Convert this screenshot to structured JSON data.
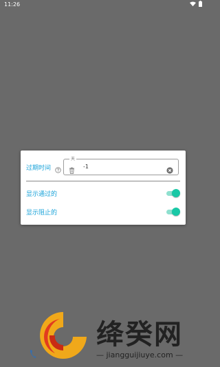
{
  "status_bar": {
    "time": "11:26",
    "icons": [
      "wifi-icon",
      "battery-icon"
    ]
  },
  "dialog": {
    "expire": {
      "label": "过期时间",
      "help_icon": "help-circle-icon",
      "input_legend": "天",
      "input_value": "-1",
      "leading_icon": "trash-icon",
      "trailing_icon": "clear-icon"
    },
    "toggles": [
      {
        "label": "显示通过的",
        "on": true
      },
      {
        "label": "显示阻止的",
        "on": true
      }
    ]
  },
  "watermark": {
    "title": "绛癸网",
    "url": "— jiangguijiuye.com —"
  },
  "colors": {
    "overlay": "#6a6a6a",
    "accent_text": "#1aa3d9",
    "switch_on": "#19c8a6"
  }
}
